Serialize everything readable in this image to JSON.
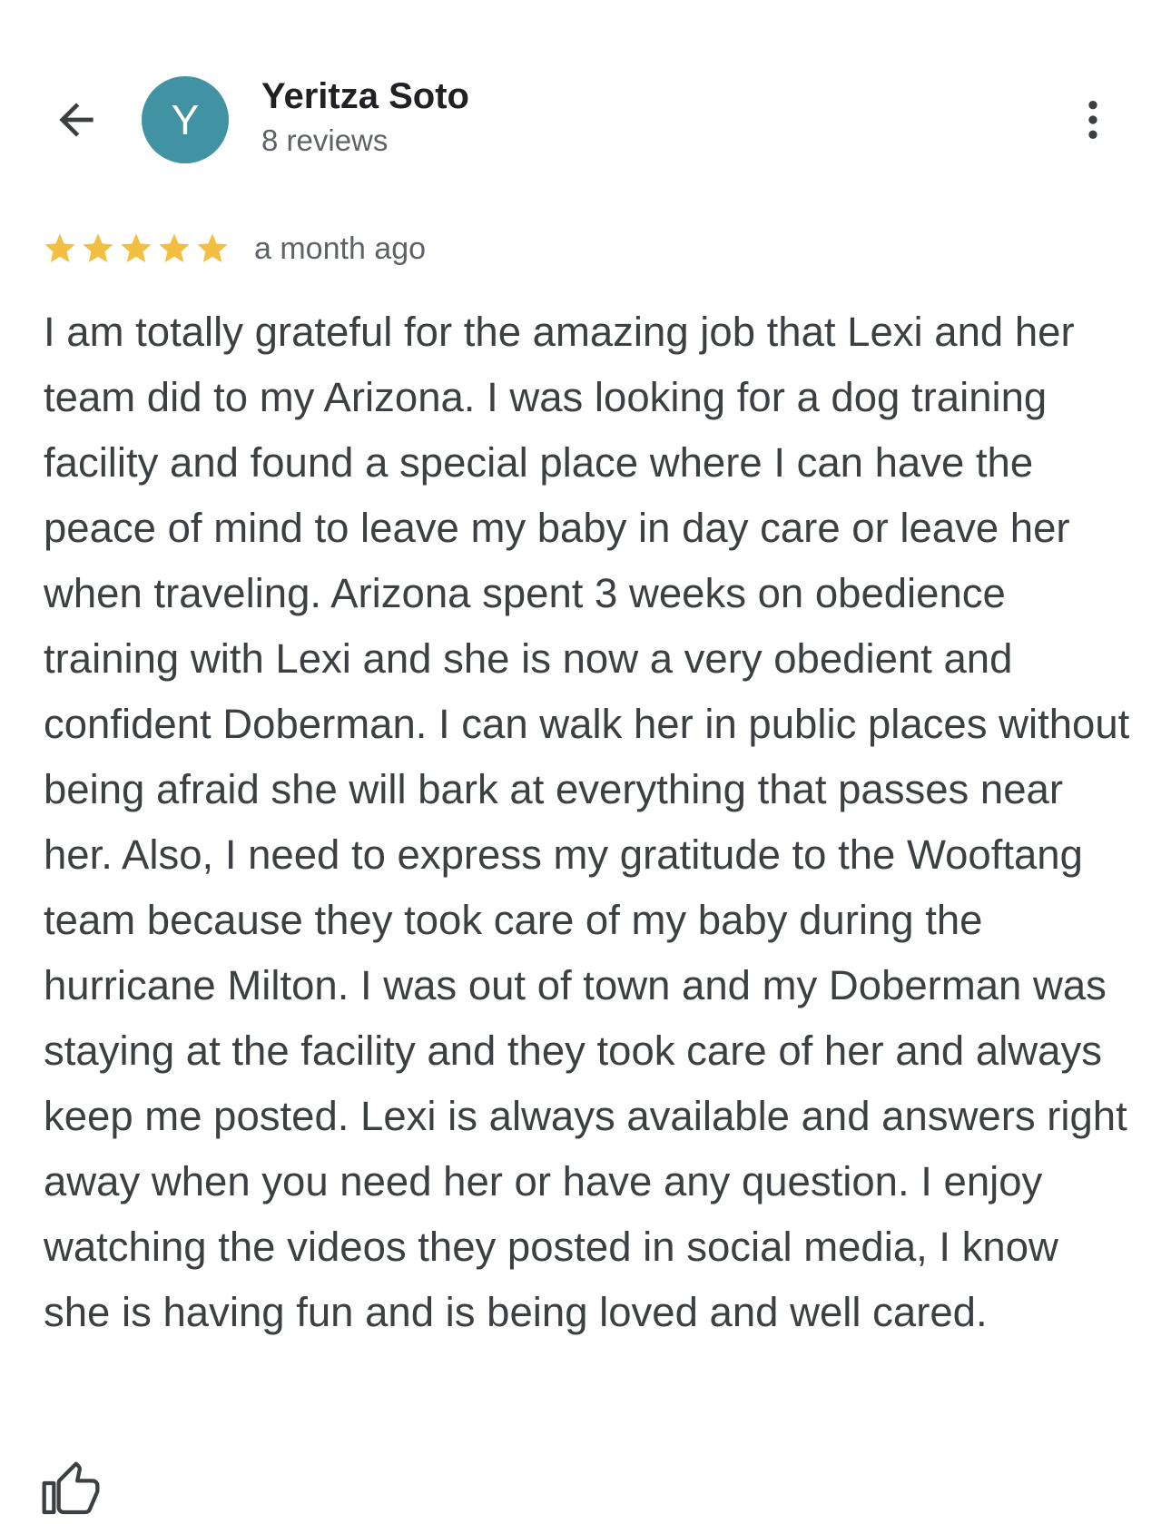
{
  "header": {
    "back_icon": "arrow-back-icon",
    "avatar_letter": "Y",
    "avatar_color": "#4193a3",
    "reviewer_name": "Yeritza Soto",
    "review_count": "8 reviews",
    "more_icon": "more-vert-icon"
  },
  "review": {
    "rating": 5,
    "rating_max": 5,
    "star_color": "#f2bf42",
    "time_ago": "a month ago",
    "text": "I am totally grateful for the amazing job that Lexi and her team did to my Arizona. I was looking for a dog training facility and found a special place where I can have the peace of mind to leave my baby in day care or leave her when traveling. Arizona spent 3 weeks on obedience training with Lexi and she is now a very obedient and confident Doberman. I can walk her in public places without being afraid she will bark at everything that passes near her. Also, I need to express my gratitude to the Wooftang team because they took care of my baby during the hurricane Milton. I was out of town and my Doberman was staying at the facility and they took care of her and always keep me posted. Lexi is always available and answers right away when you need her or have any question. I enjoy watching the videos they posted in social media, I know she is having fun and is being loved and well cared."
  },
  "actions": {
    "like_icon": "thumb-up-icon"
  }
}
